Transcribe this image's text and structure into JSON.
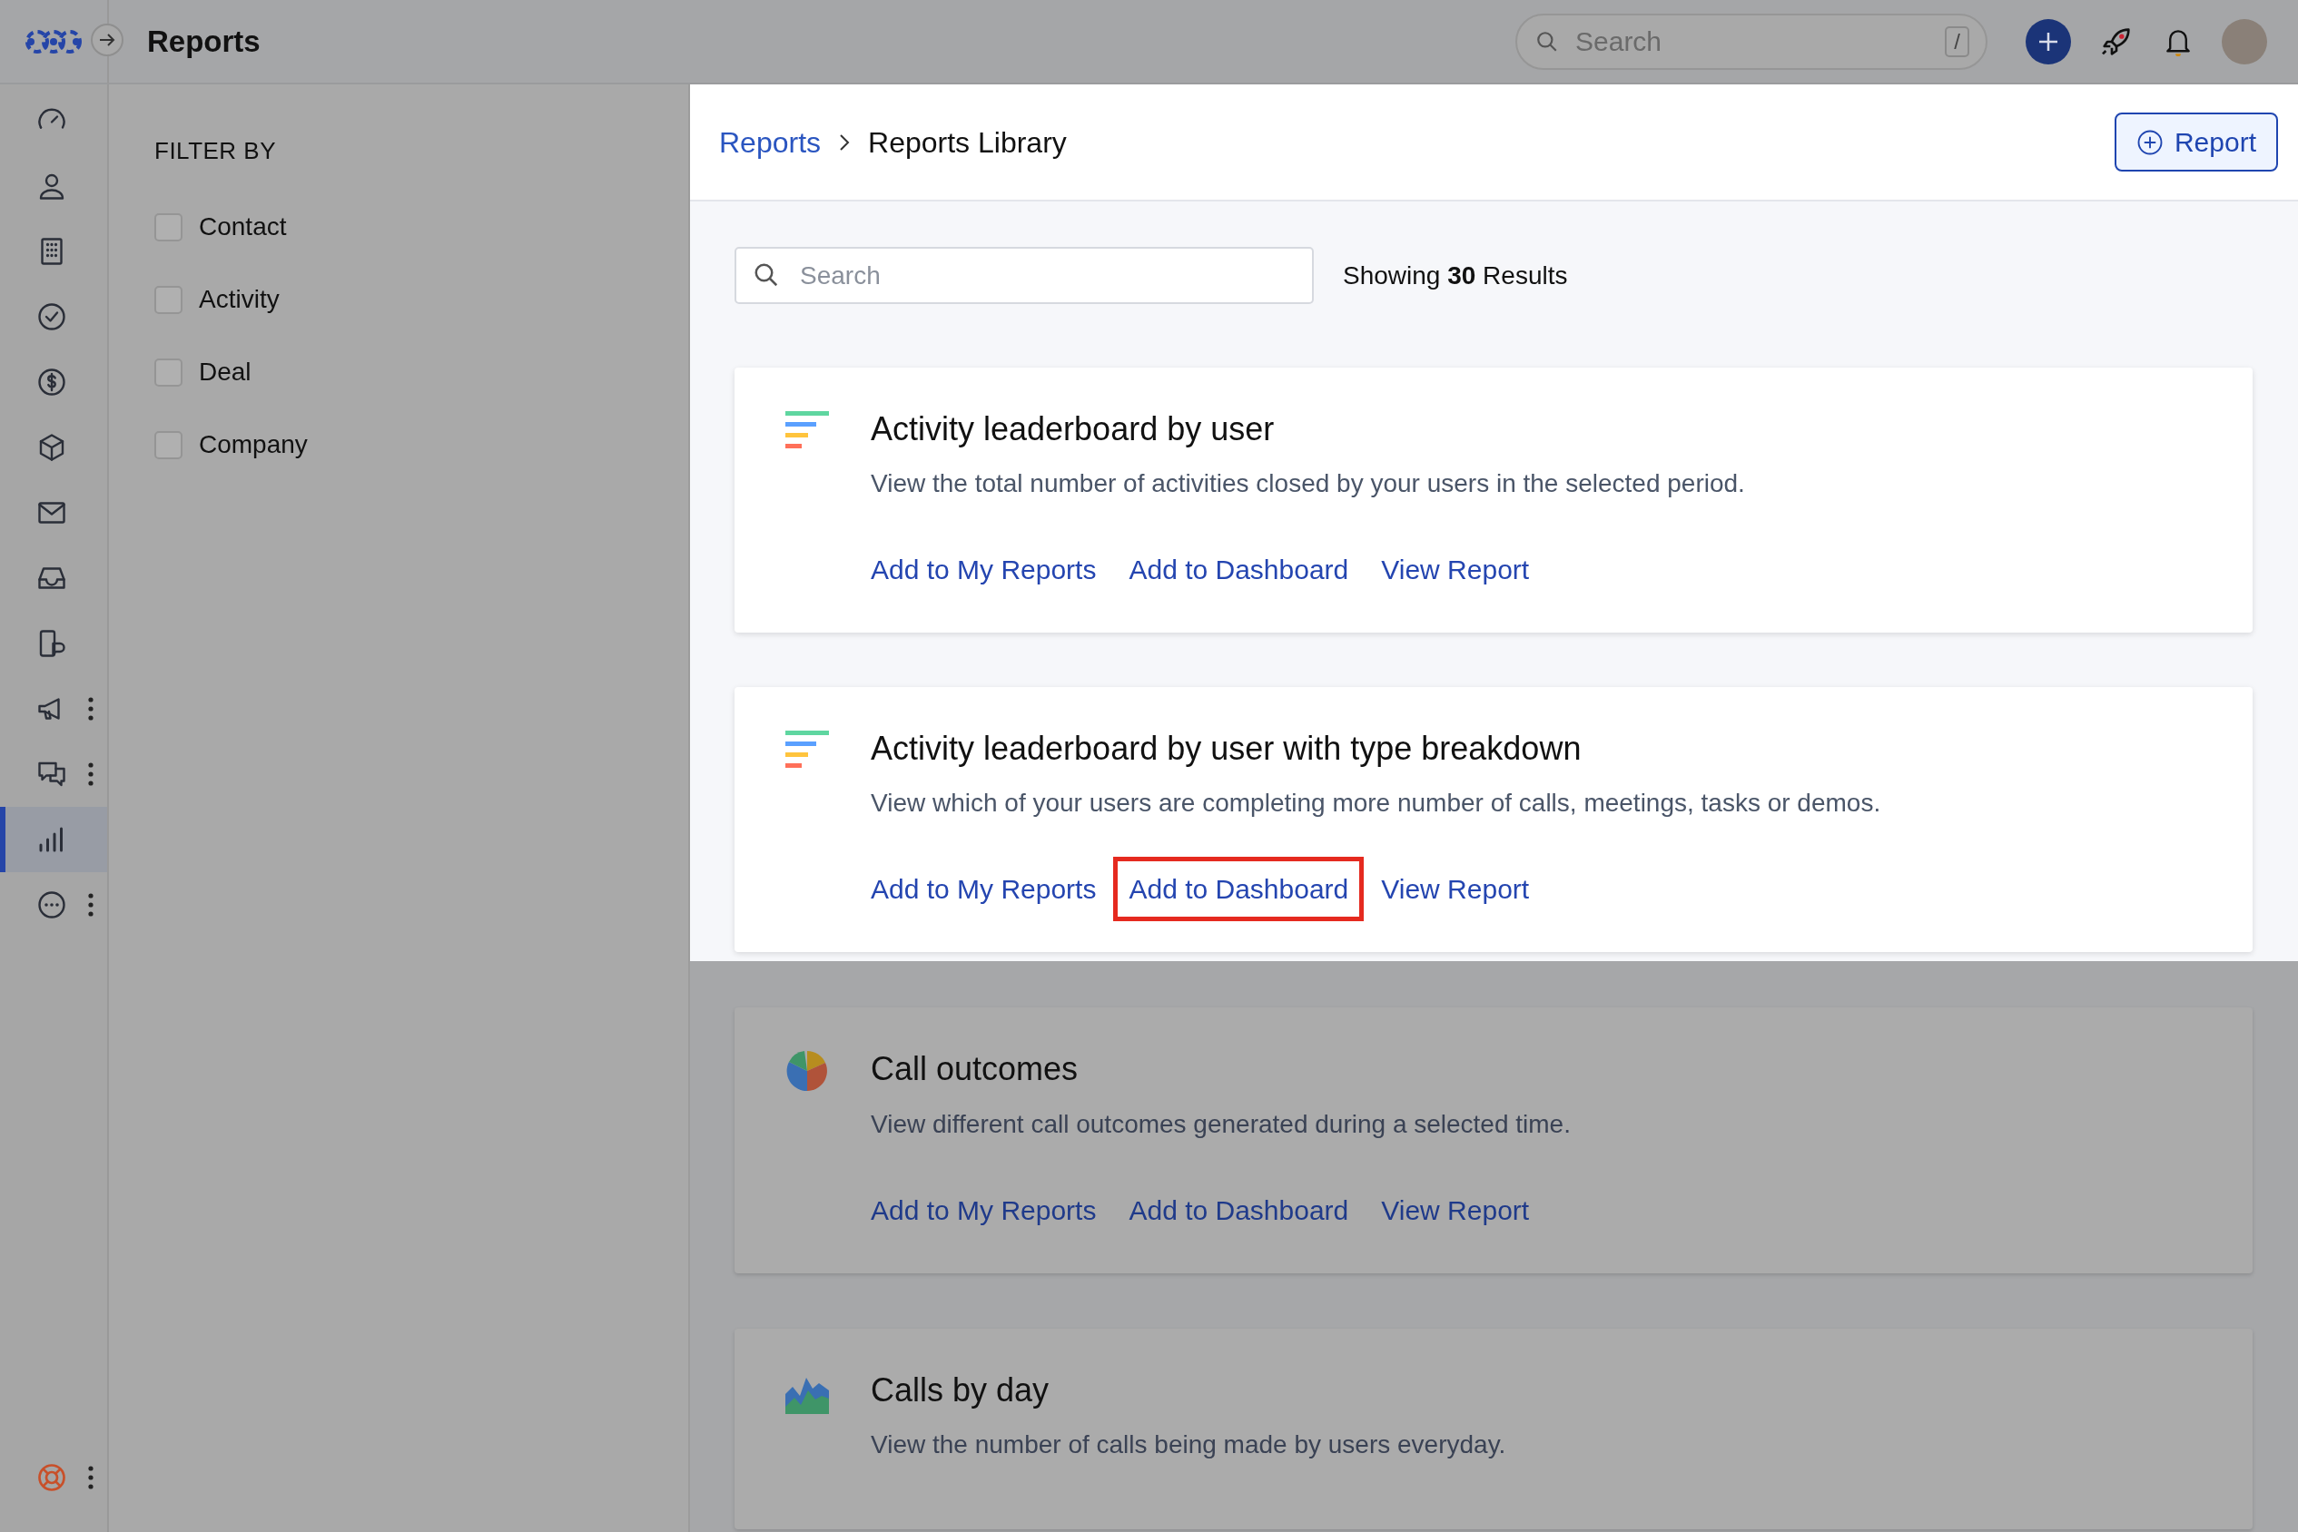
{
  "app": {
    "title": "Reports"
  },
  "topbar": {
    "search": {
      "placeholder": "Search",
      "shortcut": "/"
    }
  },
  "sidebar": {
    "items": [
      {
        "selected": false,
        "has_menu": false
      },
      {
        "selected": false,
        "has_menu": false
      },
      {
        "selected": false,
        "has_menu": false
      },
      {
        "selected": false,
        "has_menu": false
      },
      {
        "selected": false,
        "has_menu": false
      },
      {
        "selected": false,
        "has_menu": false
      },
      {
        "selected": false,
        "has_menu": false
      },
      {
        "selected": false,
        "has_menu": false
      },
      {
        "selected": false,
        "has_menu": false
      },
      {
        "selected": false,
        "has_menu": true
      },
      {
        "selected": false,
        "has_menu": true
      },
      {
        "selected": true,
        "has_menu": false
      },
      {
        "selected": false,
        "has_menu": true
      }
    ],
    "footer_item": {
      "has_menu": true
    }
  },
  "filter": {
    "heading": "FILTER BY",
    "options": [
      {
        "label": "Contact",
        "checked": false
      },
      {
        "label": "Activity",
        "checked": false
      },
      {
        "label": "Deal",
        "checked": false
      },
      {
        "label": "Company",
        "checked": false
      }
    ]
  },
  "breadcrumb": [
    {
      "label": "Reports",
      "link": true
    },
    {
      "label": "Reports Library",
      "link": false
    }
  ],
  "new_report_button": "Report",
  "search": {
    "placeholder": "Search"
  },
  "results": "Showing **30** Results",
  "cards": [
    {
      "kind": "bars",
      "spotlit": true,
      "title": "Activity leaderboard by user",
      "description": "View the total number of activities closed by your users in the selected period.",
      "actions": [
        {
          "label": "Add to My Reports",
          "highlighted": false
        },
        {
          "label": "Add to Dashboard",
          "highlighted": false
        },
        {
          "label": "View Report",
          "highlighted": false
        }
      ]
    },
    {
      "kind": "bars",
      "spotlit": true,
      "title": "Activity leaderboard by user with type breakdown",
      "description": "View which of your users are completing more number of calls, meetings, tasks or demos.",
      "actions": [
        {
          "label": "Add to My Reports",
          "highlighted": false
        },
        {
          "label": "Add to Dashboard",
          "highlighted": true
        },
        {
          "label": "View Report",
          "highlighted": false
        }
      ]
    },
    {
      "kind": "pie",
      "spotlit": false,
      "title": "Call outcomes",
      "description": "View different call outcomes generated during a selected time.",
      "actions": [
        {
          "label": "Add to My Reports",
          "highlighted": false
        },
        {
          "label": "Add to Dashboard",
          "highlighted": false
        },
        {
          "label": "View Report",
          "highlighted": false
        }
      ]
    },
    {
      "kind": "area",
      "spotlit": false,
      "title": "Calls by day",
      "description": "View the number of calls being made by users everyday."
    }
  ]
}
